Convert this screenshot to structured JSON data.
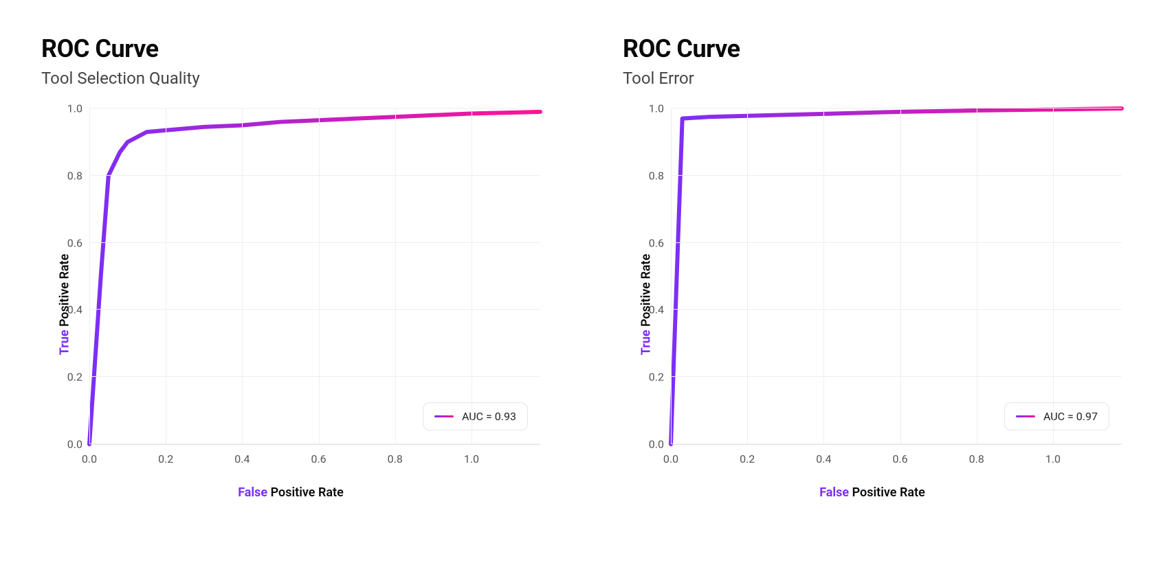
{
  "chart_data": [
    {
      "type": "line",
      "title": "ROC Curve",
      "subtitle": "Tool Selection Quality",
      "xlabel_highlight": "False",
      "xlabel_rest": " Positive Rate",
      "ylabel_highlight": "True",
      "ylabel_rest": " Positive Rate",
      "x_ticks": [
        0.0,
        0.2,
        0.4,
        0.6,
        0.8,
        1.0
      ],
      "y_ticks": [
        0.0,
        0.2,
        0.4,
        0.6,
        0.8,
        1.0
      ],
      "x_max_vis": 1.18,
      "legend_label": "AUC = 0.93",
      "series": [
        {
          "name": "AUC = 0.93",
          "color_start": "#7b2ff7",
          "color_end": "#ff1493",
          "points": [
            [
              0.0,
              0.0
            ],
            [
              0.03,
              0.5
            ],
            [
              0.05,
              0.8
            ],
            [
              0.08,
              0.87
            ],
            [
              0.1,
              0.9
            ],
            [
              0.15,
              0.93
            ],
            [
              0.2,
              0.935
            ],
            [
              0.3,
              0.945
            ],
            [
              0.4,
              0.95
            ],
            [
              0.5,
              0.96
            ],
            [
              0.6,
              0.965
            ],
            [
              0.7,
              0.97
            ],
            [
              0.8,
              0.975
            ],
            [
              0.9,
              0.98
            ],
            [
              1.0,
              0.985
            ],
            [
              1.18,
              0.99
            ]
          ]
        }
      ]
    },
    {
      "type": "line",
      "title": "ROC Curve",
      "subtitle": "Tool Error",
      "xlabel_highlight": "False",
      "xlabel_rest": " Positive Rate",
      "ylabel_highlight": "True",
      "ylabel_rest": " Positive Rate",
      "x_ticks": [
        0.0,
        0.2,
        0.4,
        0.6,
        0.8,
        1.0
      ],
      "y_ticks": [
        0.0,
        0.2,
        0.4,
        0.6,
        0.8,
        1.0
      ],
      "x_max_vis": 1.18,
      "legend_label": "AUC = 0.97",
      "series": [
        {
          "name": "AUC = 0.97",
          "color_start": "#7b2ff7",
          "color_end": "#ff1493",
          "points": [
            [
              0.0,
              0.0
            ],
            [
              0.03,
              0.97
            ],
            [
              0.1,
              0.975
            ],
            [
              0.2,
              0.978
            ],
            [
              0.4,
              0.984
            ],
            [
              0.6,
              0.99
            ],
            [
              0.8,
              0.994
            ],
            [
              1.0,
              0.997
            ],
            [
              1.18,
              1.0
            ]
          ]
        }
      ]
    }
  ]
}
